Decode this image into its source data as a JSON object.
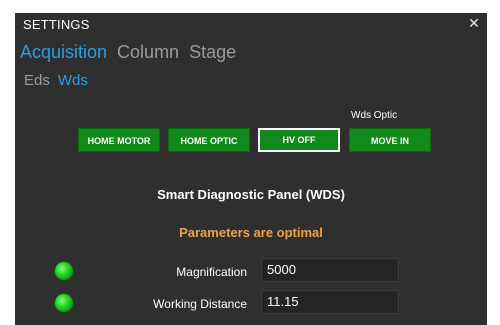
{
  "window": {
    "title": "SETTINGS",
    "close_label": "✕"
  },
  "tabs": [
    {
      "label": "Acquisition",
      "active": true
    },
    {
      "label": "Column",
      "active": false
    },
    {
      "label": "Stage",
      "active": false
    }
  ],
  "subtabs": [
    {
      "label": "Eds",
      "active": false
    },
    {
      "label": "Wds",
      "active": true
    }
  ],
  "controls": {
    "group_label": "Wds Optic",
    "buttons": [
      {
        "label": "HOME MOTOR",
        "selected": false
      },
      {
        "label": "HOME OPTIC",
        "selected": false
      },
      {
        "label": "HV OFF",
        "selected": true
      },
      {
        "label": "MOVE IN",
        "selected": false
      }
    ]
  },
  "diagnostic": {
    "title": "Smart Diagnostic Panel (WDS)",
    "status": "Parameters are optimal",
    "parameters": [
      {
        "label": "Magnification",
        "value": "5000",
        "ok": true
      },
      {
        "label": "Working Distance",
        "value": "11.15",
        "ok": true
      }
    ]
  },
  "colors": {
    "panel_bg": "#2f2f2f",
    "accent": "#2a9fe0",
    "button_green": "#12891b",
    "status_orange": "#f0a04b",
    "led_green": "#25d425"
  }
}
